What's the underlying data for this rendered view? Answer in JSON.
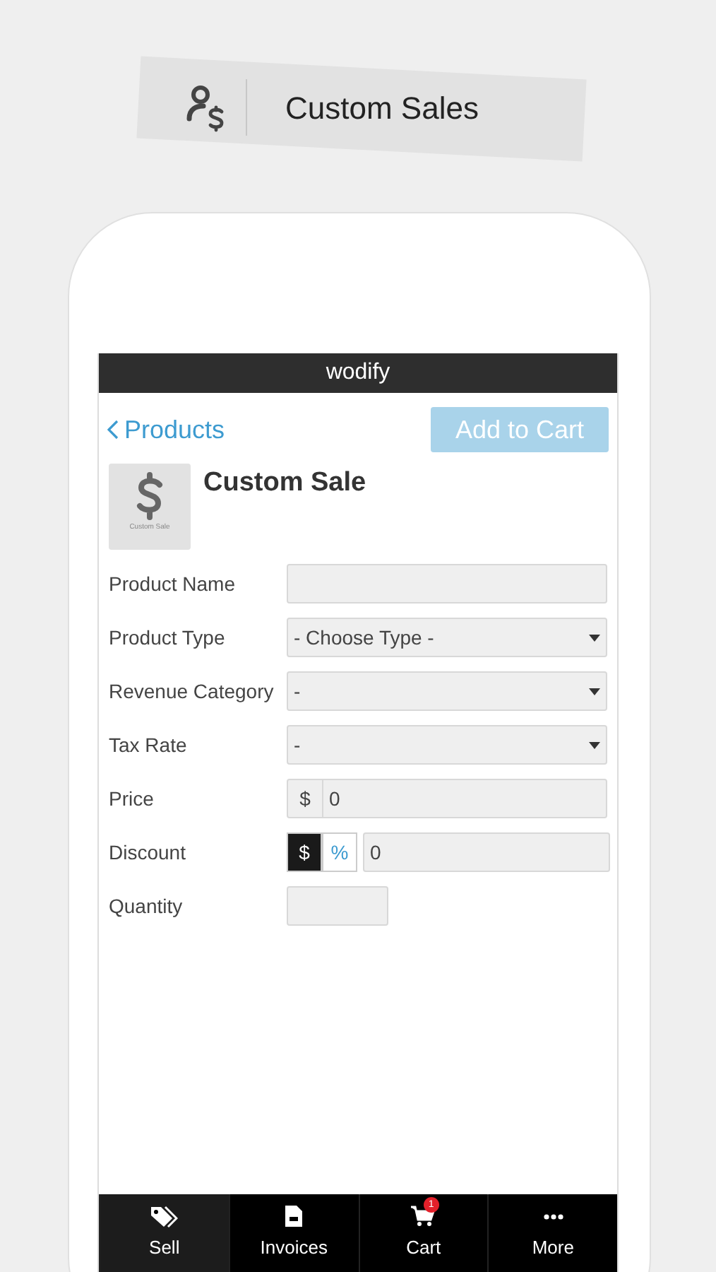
{
  "banner": {
    "title": "Custom Sales"
  },
  "app_bar": {
    "title": "wodify"
  },
  "header": {
    "back_label": "Products",
    "action_label": "Add to Cart",
    "action_disabled": true
  },
  "product": {
    "thumb_caption": "Custom Sale",
    "title": "Custom Sale"
  },
  "fields": [
    {
      "kind": "text",
      "label": "Product Name"
    },
    {
      "kind": "select",
      "label": "Product Type",
      "value": "- Choose Type -"
    },
    {
      "kind": "select",
      "label": "Revenue Category",
      "value": "-"
    },
    {
      "kind": "select",
      "label": "Tax Rate",
      "value": "-"
    },
    {
      "kind": "price",
      "label": "Price",
      "prefix": "$",
      "value": "0"
    },
    {
      "kind": "discount",
      "label": "Discount",
      "options": [
        {
          "label": "$",
          "selected": true
        },
        {
          "label": "%",
          "selected": false
        }
      ],
      "value": "0"
    },
    {
      "kind": "quantity",
      "label": "Quantity"
    }
  ],
  "tabs": [
    {
      "label": "Sell",
      "selected": true
    },
    {
      "label": "Invoices",
      "selected": false
    },
    {
      "label": "Cart",
      "selected": false,
      "badge": "1"
    },
    {
      "label": "More",
      "selected": false
    }
  ]
}
